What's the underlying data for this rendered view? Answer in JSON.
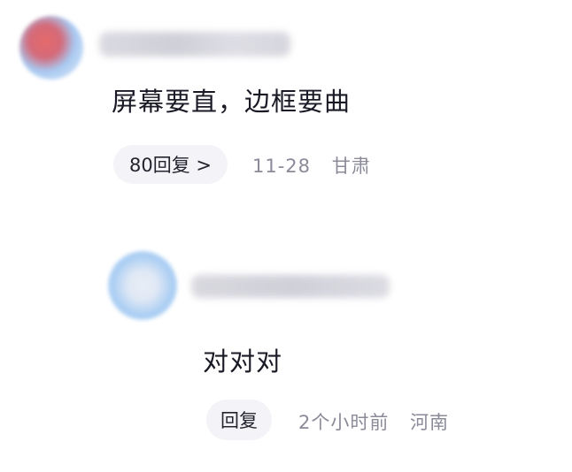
{
  "comments": [
    {
      "text": "屏幕要直，边框要曲",
      "reply_button_label": "80回复 >",
      "date": "11-28",
      "location": "甘肃"
    },
    {
      "text": "对对对",
      "reply_button_label": "回复",
      "date": "2个小时前",
      "location": "河南"
    }
  ],
  "colors": {
    "background": "#ffffff",
    "text_primary": "#1a1a26",
    "text_meta": "#8a8a99",
    "pill_background": "#f4f4f8"
  }
}
